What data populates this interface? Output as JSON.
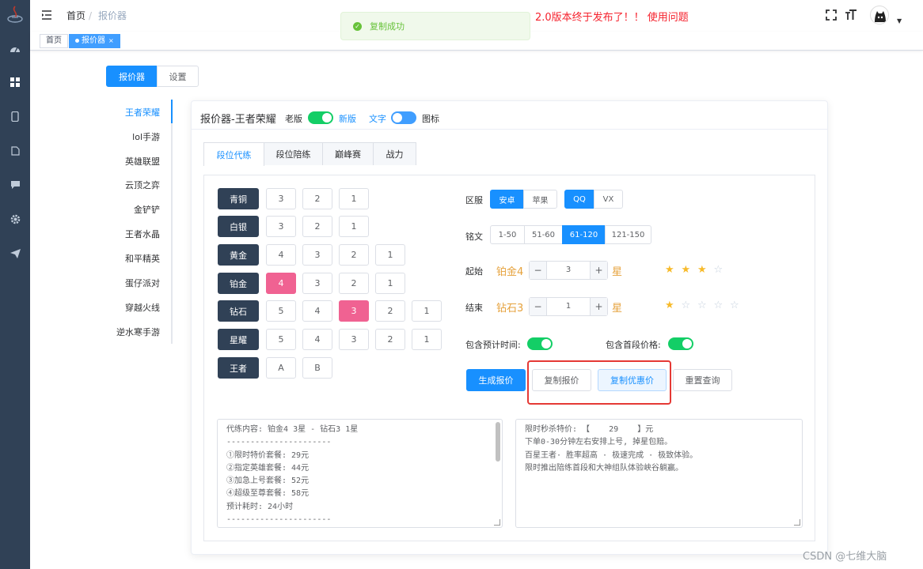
{
  "navbar": {
    "breadcrumb_home": "首页",
    "breadcrumb_separator": "/",
    "breadcrumb_current": "报价器",
    "announcement": "2.0版本终于发布了！！ 使用问题"
  },
  "tags": {
    "home": "首页",
    "current": "报价器",
    "close": "×"
  },
  "toast": {
    "message": "复制成功",
    "check": "✓"
  },
  "top_tabs": {
    "quoter": "报价器",
    "settings": "设置"
  },
  "games": [
    "王者荣耀",
    "lol手游",
    "英雄联盟",
    "云顶之弈",
    "金铲铲",
    "王者水晶",
    "和平精英",
    "蛋仔派对",
    "穿越火线",
    "逆水寒手游"
  ],
  "card": {
    "title": "报价器-王者荣耀",
    "old_label": "老版",
    "new_label": "新版",
    "text_label": "文字",
    "icon_label": "图标"
  },
  "inner_tabs": [
    "段位代练",
    "段位陪练",
    "巅峰赛",
    "战力"
  ],
  "ranks": [
    {
      "name": "青铜",
      "options": [
        "3",
        "2",
        "1"
      ],
      "selected": -1
    },
    {
      "name": "白银",
      "options": [
        "3",
        "2",
        "1"
      ],
      "selected": -1
    },
    {
      "name": "黄金",
      "options": [
        "4",
        "3",
        "2",
        "1"
      ],
      "selected": -1
    },
    {
      "name": "铂金",
      "options": [
        "4",
        "3",
        "2",
        "1"
      ],
      "selected": 0
    },
    {
      "name": "钻石",
      "options": [
        "5",
        "4",
        "3",
        "2",
        "1"
      ],
      "selected": 2
    },
    {
      "name": "星耀",
      "options": [
        "5",
        "4",
        "3",
        "2",
        "1"
      ],
      "selected": -1
    },
    {
      "name": "王者",
      "options": [
        "A",
        "B"
      ],
      "selected": -1
    }
  ],
  "server": {
    "label": "区服",
    "platforms": [
      "安卓",
      "苹果"
    ],
    "platform_selected": 0,
    "channels": [
      "QQ",
      "VX"
    ],
    "channel_selected": 0
  },
  "inscription": {
    "label": "铭文",
    "options": [
      "1-50",
      "51-60",
      "61-120",
      "121-150"
    ],
    "selected": 2
  },
  "start": {
    "label": "起始",
    "rank": "铂金4",
    "value": "3",
    "unit": "星",
    "stars_filled": 3,
    "stars_total": 4,
    "minus": "−",
    "plus": "+"
  },
  "end": {
    "label": "结束",
    "rank": "钻石3",
    "value": "1",
    "unit": "星",
    "stars_filled": 1,
    "stars_total": 5,
    "minus": "−",
    "plus": "+"
  },
  "toggles": {
    "include_time": "包含预计时间:",
    "include_first_price": "包含首段价格:"
  },
  "actions": {
    "generate": "生成报价",
    "copy_quote": "复制报价",
    "copy_discount": "复制优惠价",
    "reset": "重置查询"
  },
  "quote_text": [
    "代练内容: 铂金4 3星 - 钻石3 1星",
    "----------------------",
    "①限时特价套餐: 29元",
    "②指定英雄套餐: 44元",
    "③加急上号套餐: 52元",
    "④超级至尊套餐: 58元",
    "预计耗时: 24小时",
    "----------------------"
  ],
  "discount_text": [
    "限时秒杀特价: 【    29    】元",
    "下单0-30分钟左右安排上号, 掉星包赔。",
    "百星王者· 胜率超高 · 极速完成 · 极致体验。",
    "限时推出陪练首段和大神组队体验峡谷躺赢。"
  ],
  "watermark": "CSDN @七维大脑",
  "colors": {
    "primary": "#1890ff",
    "dark": "#304156",
    "pink": "#f06292",
    "switch_on": "#13ce66",
    "star": "#f7ba2a",
    "highlight_box": "#e53935"
  }
}
